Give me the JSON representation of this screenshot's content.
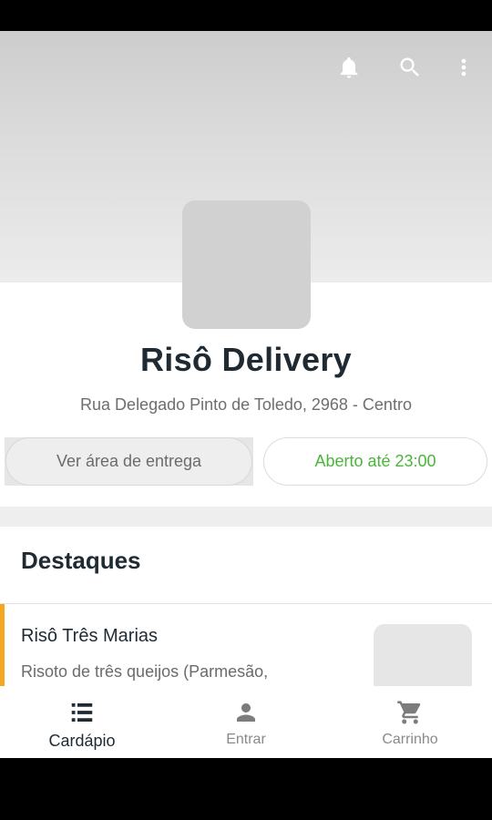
{
  "store": {
    "name": "Risô Delivery",
    "address": "Rua Delegado Pinto de Toledo, 2968 - Centro"
  },
  "actions": {
    "delivery_area_label": "Ver área de entrega",
    "open_status_label": "Aberto até 23:00"
  },
  "toolbar": {
    "icons": [
      "bell-icon",
      "search-icon",
      "more-vertical-icon"
    ]
  },
  "highlights": {
    "title": "Destaques",
    "items": [
      {
        "name": "Risô Três Marias",
        "description": "Risoto de três queijos (Parmesão,"
      }
    ]
  },
  "bottom_nav": {
    "items": [
      {
        "label": "Cardápio",
        "icon": "menu-list-icon",
        "active": true
      },
      {
        "label": "Entrar",
        "icon": "person-icon",
        "active": false
      },
      {
        "label": "Carrinho",
        "icon": "cart-icon",
        "active": false
      }
    ]
  },
  "colors": {
    "accent_orange": "#f5a623",
    "open_green": "#4bb43b",
    "title_dark": "#1f2a33"
  }
}
